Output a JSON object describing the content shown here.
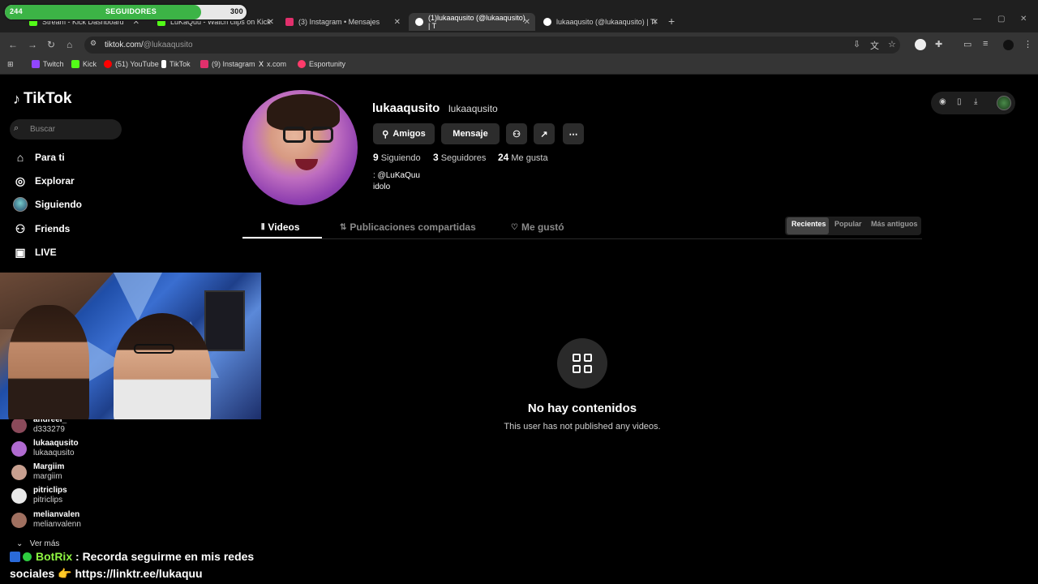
{
  "browser": {
    "tabs": [
      {
        "label": "Stream - Kick Dashboard",
        "color": "#53fc18"
      },
      {
        "label": "LuKaQuu - Watch clips on Kick",
        "color": "#53fc18"
      },
      {
        "label": "(3) Instagram • Mensajes",
        "color": "#e1306c"
      },
      {
        "label": "(1)lukaaqusito (@lukaaqusito) | T",
        "color": "#ffffff"
      },
      {
        "label": "lukaaqusito (@lukaaqusito) | Ti",
        "color": "#ffffff"
      }
    ],
    "url_host": "tiktok.com/",
    "url_path": "@lukaaqusito",
    "bookmarks": [
      {
        "label": "Twitch",
        "color": "#9146ff"
      },
      {
        "label": "Kick",
        "color": "#53fc18"
      },
      {
        "label": "(51) YouTube",
        "color": "#ff0000"
      },
      {
        "label": "TikTok",
        "color": "#ffffff"
      },
      {
        "label": "(9) Instagram",
        "color": "#e1306c"
      },
      {
        "label": "x.com",
        "color": "#ffffff"
      },
      {
        "label": "Esportunity",
        "color": "#ff3b6b"
      }
    ]
  },
  "follower_goal": {
    "current": "244",
    "label": "SEGUIDORES",
    "target": "300",
    "progress": 0.813
  },
  "sidebar": {
    "logo": "TikTok",
    "search_placeholder": "Buscar",
    "nav": [
      {
        "label": "Para ti",
        "icon": "home-icon"
      },
      {
        "label": "Explorar",
        "icon": "compass-icon"
      },
      {
        "label": "Siguiendo",
        "icon": "avatar-icon"
      },
      {
        "label": "Friends",
        "icon": "friends-icon"
      },
      {
        "label": "LIVE",
        "icon": "live-icon"
      }
    ],
    "following": [
      {
        "name": "andreei_",
        "user": "d333279",
        "color": "#8a4a5a"
      },
      {
        "name": "lukaaqusito",
        "user": "lukaaqusito",
        "color": "#b06ad0"
      },
      {
        "name": "Margiim",
        "user": "margiim",
        "color": "#c8a090"
      },
      {
        "name": "pitriclips",
        "user": "pitriclips",
        "color": "#e8e8e8"
      },
      {
        "name": "melianvalen",
        "user": "melianvalenn",
        "color": "#a07060"
      }
    ],
    "see_more": "Ver más"
  },
  "profile": {
    "display_name": "lukaaqusito",
    "username": "lukaaqusito",
    "btn_friends": "Amigos",
    "btn_message": "Mensaje",
    "following_count": "9",
    "following_label": "Siguiendo",
    "followers_count": "3",
    "followers_label": "Seguidores",
    "likes_count": "24",
    "likes_label": "Me gusta",
    "bio_line1": ": @LuKaQuu",
    "bio_line2": "idolo"
  },
  "tabs": {
    "videos": "Videos",
    "reposts": "Publicaciones compartidas",
    "liked": "Me gustó"
  },
  "sort": {
    "recent": "Recientes",
    "popular": "Popular",
    "oldest": "Más antiguos"
  },
  "empty": {
    "title": "No hay contenidos",
    "subtitle": "This user has not published any videos."
  },
  "chat": {
    "bot": "BotRix",
    "message": ": Recorda seguirme en mis redes sociales 👉 https://linktr.ee/lukaquu"
  }
}
